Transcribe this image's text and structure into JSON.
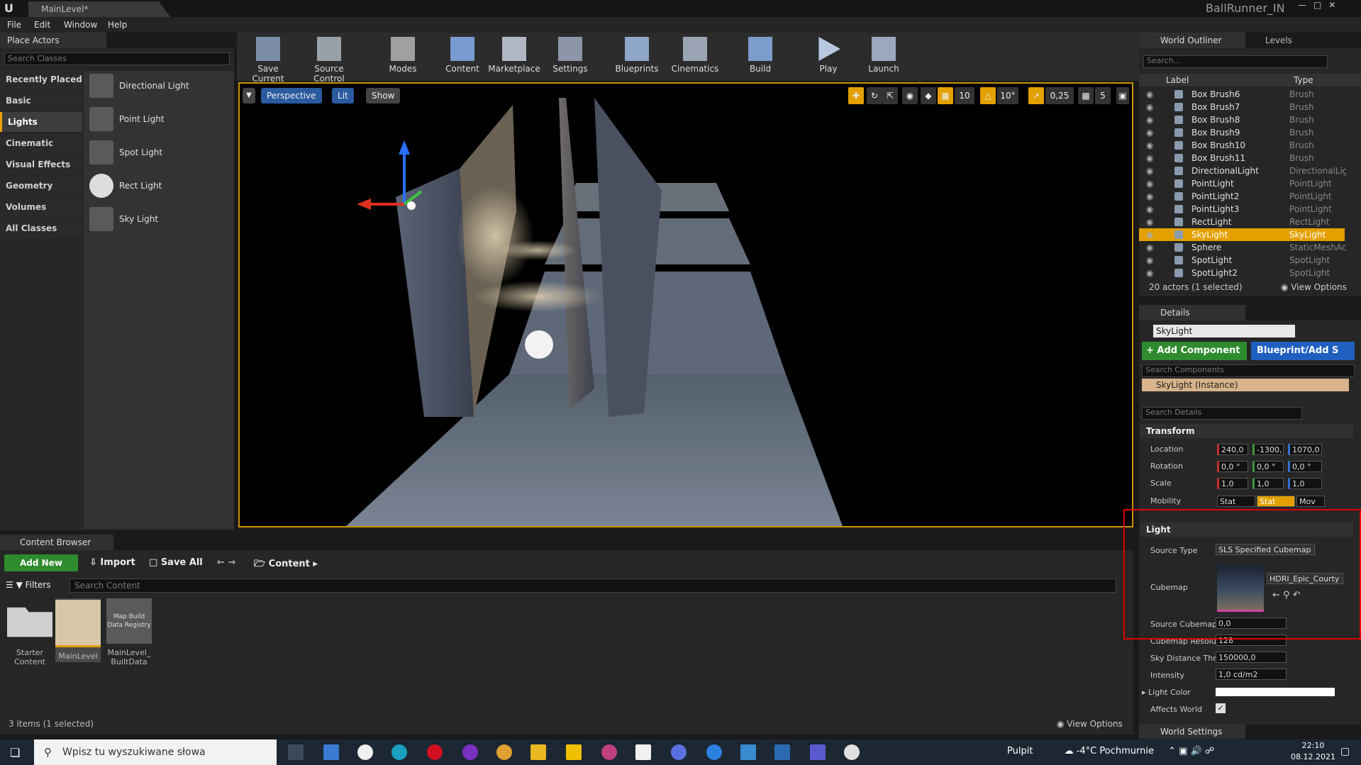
{
  "title_bar": {
    "tab": "MainLevel*",
    "project": "BallRunner_IN"
  },
  "menu": [
    "File",
    "Edit",
    "Window",
    "Help"
  ],
  "place_actors": {
    "tab": "Place Actors",
    "search_placeholder": "Search Classes",
    "categories": [
      "Recently Placed",
      "Basic",
      "Lights",
      "Cinematic",
      "Visual Effects",
      "Geometry",
      "Volumes",
      "All Classes"
    ],
    "selected_category": "Lights",
    "actors": [
      "Directional Light",
      "Point Light",
      "Spot Light",
      "Rect Light",
      "Sky Light"
    ]
  },
  "toolbar": [
    "Save Current",
    "Source Control",
    "Modes",
    "Content",
    "Marketplace",
    "Settings",
    "Blueprints",
    "Cinematics",
    "Build",
    "Play",
    "Launch"
  ],
  "viewport": {
    "buttons": [
      "Perspective",
      "Lit",
      "Show"
    ],
    "grid_snap": "10",
    "rot_snap": "10°",
    "scale_snap": "0,25",
    "cam_speed": "5"
  },
  "content_browser": {
    "tab": "Content Browser",
    "add_new": "Add New",
    "import": "Import",
    "save_all": "Save All",
    "path": "Content",
    "filters": "Filters",
    "search_placeholder": "Search Content",
    "assets": [
      {
        "name": "Starter Content",
        "kind": "folder"
      },
      {
        "name": "MainLevel",
        "kind": "level"
      },
      {
        "name": "MainLevel_ BuiltData",
        "kind": "data",
        "thumb_text": "Map Build Data Registry"
      }
    ],
    "status": "3 items (1 selected)",
    "view_options": "View Options"
  },
  "outliner": {
    "tab": "World Outliner",
    "levels_tab": "Levels",
    "search_placeholder": "Search...",
    "col_label": "Label",
    "col_type": "Type",
    "rows": [
      {
        "name": "Box Brush6",
        "type": "Brush"
      },
      {
        "name": "Box Brush7",
        "type": "Brush"
      },
      {
        "name": "Box Brush8",
        "type": "Brush"
      },
      {
        "name": "Box Brush9",
        "type": "Brush"
      },
      {
        "name": "Box Brush10",
        "type": "Brush"
      },
      {
        "name": "Box Brush11",
        "type": "Brush"
      },
      {
        "name": "DirectionalLight",
        "type": "DirectionalLigh"
      },
      {
        "name": "PointLight",
        "type": "PointLight"
      },
      {
        "name": "PointLight2",
        "type": "PointLight"
      },
      {
        "name": "PointLight3",
        "type": "PointLight"
      },
      {
        "name": "RectLight",
        "type": "RectLight"
      },
      {
        "name": "SkyLight",
        "type": "SkyLight"
      },
      {
        "name": "Sphere",
        "type": "StaticMeshAct"
      },
      {
        "name": "SpotLight",
        "type": "SpotLight"
      },
      {
        "name": "SpotLight2",
        "type": "SpotLight"
      }
    ],
    "selected_index": 11,
    "status": "20 actors (1 selected)",
    "view_options": "View Options"
  },
  "details": {
    "tab": "Details",
    "name": "SkyLight",
    "add_component": "+ Add Component",
    "blueprint": "Blueprint/Add S",
    "search_components": "Search Components",
    "component": "SkyLight (Instance)",
    "search_details": "Search Details",
    "transform_label": "Transform",
    "location_label": "Location",
    "location": [
      "240,0",
      "-1300,",
      "1070,0"
    ],
    "rotation_label": "Rotation",
    "rotation": [
      "0,0 °",
      "0,0 °",
      "0,0 °"
    ],
    "scale_label": "Scale",
    "scale": [
      "1,0",
      "1,0",
      "1,0"
    ],
    "mobility_label": "Mobility",
    "mobility": [
      "Stat",
      "Stat",
      "Mov"
    ],
    "light_label": "Light",
    "source_type_label": "Source Type",
    "source_type": "SLS Specified Cubemap",
    "cubemap_label": "Cubemap",
    "cubemap": "HDRI_Epic_Courty",
    "source_cubemap_label": "Source Cubemap",
    "source_cubemap": "0,0",
    "cubemap_res_label": "Cubemap Resolut",
    "cubemap_res": "128",
    "sky_distance_label": "Sky Distance Thr",
    "sky_distance": "150000,0",
    "intensity_label": "Intensity",
    "intensity": "1,0 cd/m2",
    "light_color_label": "Light Color",
    "affects_world_label": "Affects World",
    "world_settings": "World Settings"
  },
  "taskbar": {
    "search": "Wpisz tu wyszukiwane słowa",
    "desktop": "Pulpit",
    "weather": "-4°C  Pochmurnie",
    "time": "22:10",
    "date": "08.12.2021"
  }
}
